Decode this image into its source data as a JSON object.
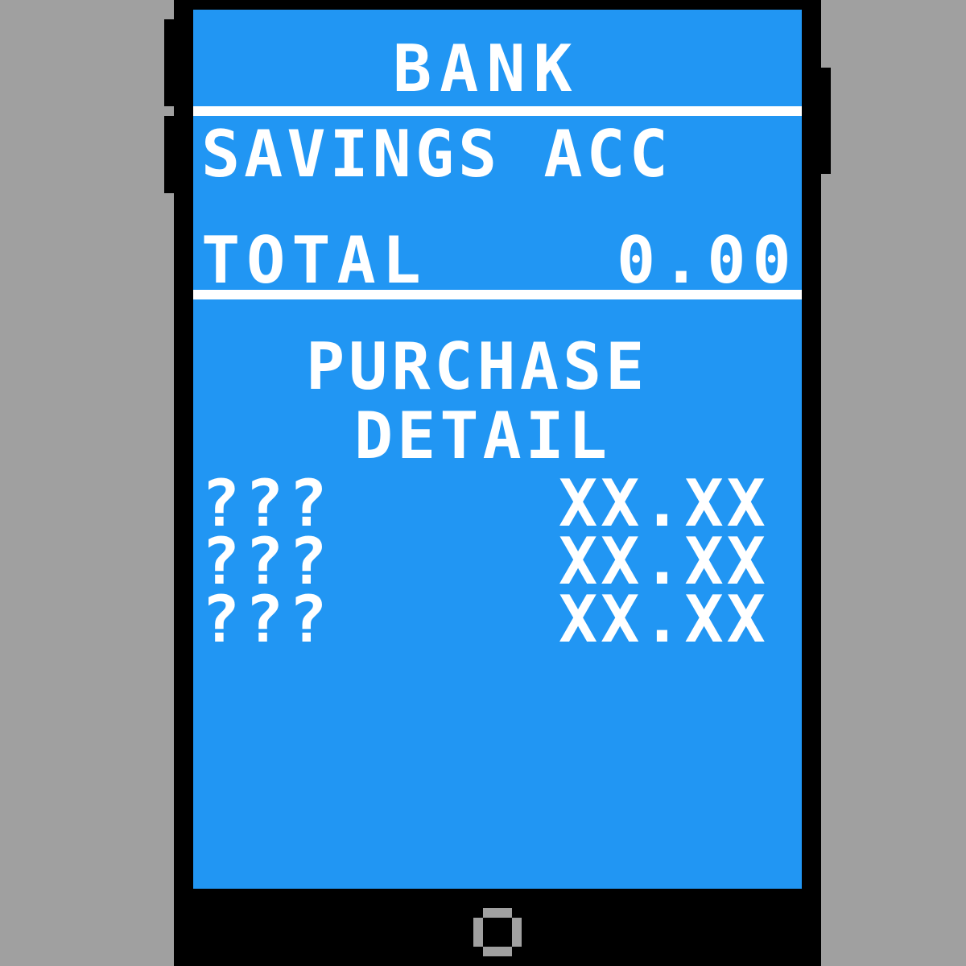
{
  "app": {
    "title": "BANK"
  },
  "account": {
    "name": "SAVINGS ACC",
    "total_label": "TOTAL",
    "total_value": "0.00"
  },
  "purchases": {
    "heading_line1": "PURCHASE",
    "heading_line2": "DETAIL",
    "items": [
      {
        "name": "???",
        "amount": "XX.XX"
      },
      {
        "name": "???",
        "amount": "XX.XX"
      },
      {
        "name": "???",
        "amount": "XX.XX"
      }
    ]
  },
  "colors": {
    "screen": "#2196f3",
    "text": "#ffffff",
    "bezel": "#000000",
    "background": "#a0a0a0",
    "home_button": "#a0a0a0"
  },
  "icons": {
    "home_button": "home-button-icon"
  }
}
